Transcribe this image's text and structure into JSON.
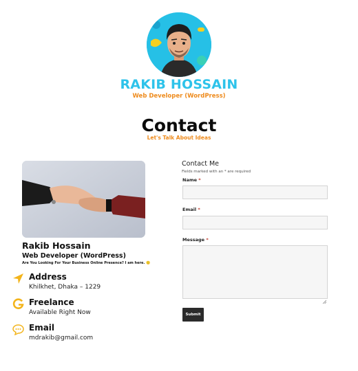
{
  "header": {
    "name": "RAKIB HOSSAIN",
    "role": "Web Developer (WordPress)"
  },
  "contact": {
    "title": "Contact",
    "subtitle": "Let's Talk About Ideas"
  },
  "profile": {
    "name": "Rakib Hossain",
    "role": "Web Developer (WordPress)",
    "tagline": "Are You Looking For Your Business Online Presence? I am here. 🙂"
  },
  "info": [
    {
      "icon": "location-arrow-icon",
      "label": "Address",
      "value": "Khilkhet, Dhaka – 1229"
    },
    {
      "icon": "g-logo-icon",
      "label": "Freelance",
      "value": "Available Right Now"
    },
    {
      "icon": "chat-bubble-icon",
      "label": "Email",
      "value": "mdrakib@gmail.com"
    }
  ],
  "form": {
    "title": "Contact Me",
    "note": "Fields marked with an * are required",
    "name_label": "Name",
    "email_label": "Email",
    "message_label": "Message",
    "required_mark": "*",
    "submit_label": "Submit",
    "name_value": "",
    "email_value": "",
    "message_value": ""
  },
  "colors": {
    "accent_blue": "#2ec3ea",
    "accent_orange": "#ee8b1d",
    "icon_yellow": "#f3b41b",
    "button_dark": "#2b2b2b"
  }
}
